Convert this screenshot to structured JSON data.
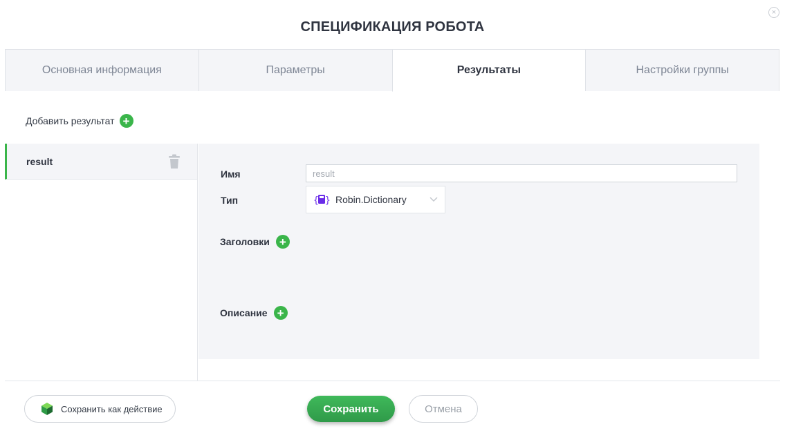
{
  "dialog": {
    "title": "СПЕЦИФИКАЦИЯ РОБОТА",
    "close_glyph": "×"
  },
  "tabs": [
    {
      "label": "Основная информация",
      "active": false
    },
    {
      "label": "Параметры",
      "active": false
    },
    {
      "label": "Результаты",
      "active": true
    },
    {
      "label": "Настройки группы",
      "active": false
    }
  ],
  "results": {
    "add_label": "Добавить результат",
    "items": [
      {
        "label": "result",
        "selected": true
      }
    ]
  },
  "detail": {
    "name_label": "Имя",
    "name_placeholder": "result",
    "type_label": "Тип",
    "type_value": "Robin.Dictionary",
    "headers_label": "Заголовки",
    "description_label": "Описание"
  },
  "footer": {
    "save_action_label": "Сохранить как действие",
    "save_label": "Сохранить",
    "cancel_label": "Отмена"
  },
  "icons": {
    "close": "close-icon",
    "add": "plus-circle-icon",
    "delete": "trash-icon",
    "type": "dictionary-icon",
    "dropdown": "chevron-down-icon",
    "save_action": "cube-icon"
  },
  "colors": {
    "accent_green": "#3ab54a",
    "panel_bg": "#f4f5f8",
    "text_dark": "#2f3440",
    "tab_inactive_text": "#7d8594",
    "dictionary_icon": "#6a2ce8"
  }
}
